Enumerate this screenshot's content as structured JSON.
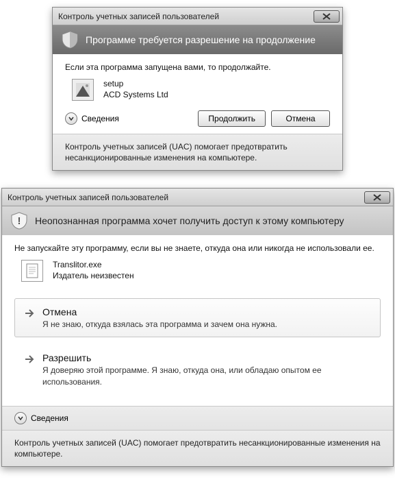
{
  "dialog1": {
    "title": "Контроль учетных записей пользователей",
    "banner": "Программе требуется разрешение на продолжение",
    "instruction": "Если эта программа запущена вами, то продолжайте.",
    "program_name": "setup",
    "publisher": "ACD Systems Ltd",
    "details_label": "Сведения",
    "continue_label": "Продолжить",
    "cancel_label": "Отмена",
    "footer": "Контроль учетных записей (UAC) помогает предотвратить несанкционированные изменения на компьютере."
  },
  "dialog2": {
    "title": "Контроль учетных записей пользователей",
    "banner": "Неопознанная программа хочет получить доступ к этому компьютеру",
    "instruction": "Не запускайте эту программу, если вы не знаете, откуда она или никогда не использовали ее.",
    "program_name": "Translitor.exe",
    "publisher": "Издатель неизвестен",
    "option_cancel_title": "Отмена",
    "option_cancel_desc": "Я не знаю, откуда взялась эта программа и зачем она нужна.",
    "option_allow_title": "Разрешить",
    "option_allow_desc": "Я доверяю этой программе. Я знаю, откуда она, или обладаю опытом ее использования.",
    "details_label": "Сведения",
    "footer": "Контроль учетных записей (UAC) помогает предотвратить несанкционированные изменения на компьютере."
  }
}
